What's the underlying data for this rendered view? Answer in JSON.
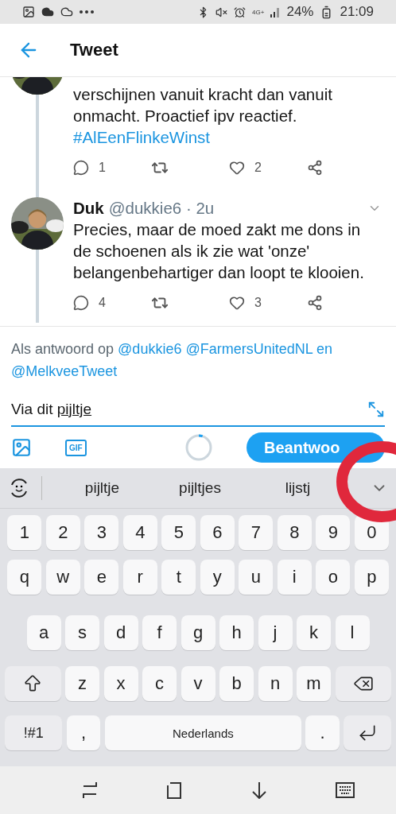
{
  "status_bar": {
    "network": "4G+",
    "battery": "24%",
    "time": "21:09"
  },
  "header": {
    "title": "Tweet"
  },
  "tweets": [
    {
      "text": "verschijnen vanuit kracht dan vanuit onmacht. Proactief ipv reactief.",
      "hashtag": "#AlEenFlinkeWinst",
      "replies": "1",
      "likes": "2"
    },
    {
      "name": "Duk",
      "meta": "@dukkie6 · 2u",
      "text": "Precies, maar de moed zakt me dons in de schoenen als ik zie wat 'onze' belangenbehartiger dan loopt te klooien.",
      "replies": "4",
      "likes": "3"
    }
  ],
  "reply_context": {
    "prefix": "Als antwoord op",
    "mentions": [
      "@dukkie6",
      "@FarmersUnitedNL"
    ],
    "joiner": "en",
    "last_mention": "@MelkveeTweet"
  },
  "compose": {
    "value": "Via dit",
    "composing_word": "pijltje"
  },
  "char_progress": {
    "level": 0.05
  },
  "media_tools": {
    "gif_label": "GIF"
  },
  "reply_button": {
    "label": "Beantwoo"
  },
  "suggestions": [
    "pijltje",
    "pijltjes",
    "lijstj"
  ],
  "keyboard": {
    "key_rows": [
      {
        "keys": [
          "1",
          "2",
          "3",
          "4",
          "5",
          "6",
          "7",
          "8",
          "9",
          "0"
        ]
      },
      {
        "keys": [
          "q",
          "w",
          "e",
          "r",
          "t",
          "y",
          "u",
          "i",
          "o",
          "p"
        ]
      },
      {
        "keys": [
          "a",
          "s",
          "d",
          "f",
          "g",
          "h",
          "j",
          "k",
          "l"
        ]
      },
      {
        "keys": [
          {
            "kind": "shift"
          },
          "z",
          "x",
          "c",
          "v",
          "b",
          "n",
          "m",
          {
            "kind": "backspace"
          }
        ]
      },
      {
        "keys": [
          {
            "kind": "symbols",
            "label": "!#1"
          },
          ",",
          {
            "kind": "space",
            "label": "Nederlands"
          },
          ".",
          {
            "kind": "enter"
          }
        ]
      }
    ]
  }
}
